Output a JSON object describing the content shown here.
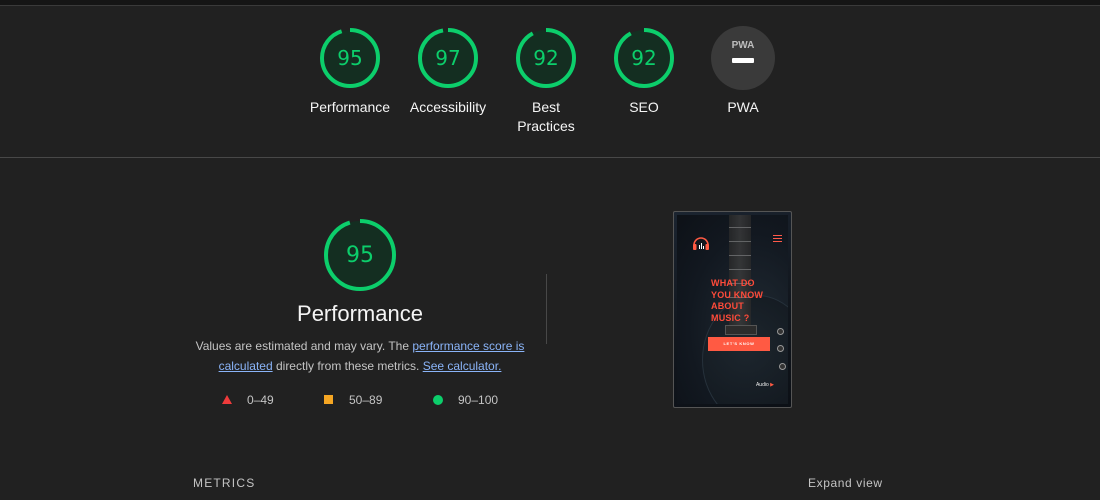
{
  "colors": {
    "background": "#212121",
    "pass": "#0cce6b",
    "average": "#f5a623",
    "fail": "#ef3b3b",
    "pwa_badge": "#3a3a3a",
    "link": "#8ab4f8"
  },
  "scores": [
    {
      "label": "Performance",
      "value": "95",
      "fraction": 0.95
    },
    {
      "label": "Accessibility",
      "value": "97",
      "fraction": 0.97
    },
    {
      "label": "Best Practices",
      "value": "92",
      "fraction": 0.92
    },
    {
      "label": "SEO",
      "value": "92",
      "fraction": 0.92
    }
  ],
  "pwa": {
    "label": "PWA",
    "badge_text": "PWA"
  },
  "performance": {
    "score": "95",
    "fraction": 0.95,
    "title": "Performance",
    "desc_part1": "Values are estimated and may vary. The ",
    "link_score": "performance score is calculated",
    "desc_part2": " directly from these metrics. ",
    "link_calc": "See calculator.",
    "legend": [
      {
        "range": "0–49",
        "shape": "triangle"
      },
      {
        "range": "50–89",
        "shape": "square"
      },
      {
        "range": "90–100",
        "shape": "circle"
      }
    ]
  },
  "screenshot": {
    "hero_line1": "WHAT DO",
    "hero_line2": "YOU KNOW",
    "hero_line3": "ABOUT",
    "hero_line4": "MUSIC ?",
    "button": "LET'S KNOW",
    "audio_label": "Audio"
  },
  "metrics": {
    "label": "METRICS",
    "expand": "Expand view"
  }
}
